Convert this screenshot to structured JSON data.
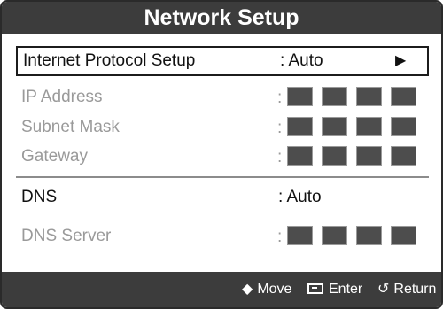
{
  "window": {
    "title": "Network Setup"
  },
  "protocol": {
    "label": "Internet Protocol Setup",
    "value": ": Auto",
    "arrow": "▶"
  },
  "ip": {
    "label": "IP Address",
    "colon": ":"
  },
  "subnet": {
    "label": "Subnet Mask",
    "colon": ":"
  },
  "gateway": {
    "label": "Gateway",
    "colon": ":"
  },
  "dns": {
    "label": "DNS",
    "value": ": Auto"
  },
  "dns_server": {
    "label": "DNS Server",
    "colon": ":"
  },
  "footer": {
    "move_glyph": "◆",
    "move_label": "Move",
    "enter_label": "Enter",
    "return_glyph": "↺",
    "return_label": "Return"
  },
  "colors": {
    "bar": "#3c3c3c",
    "dim_text": "#9a9a9a",
    "input_cell": "#4d4d4d"
  }
}
